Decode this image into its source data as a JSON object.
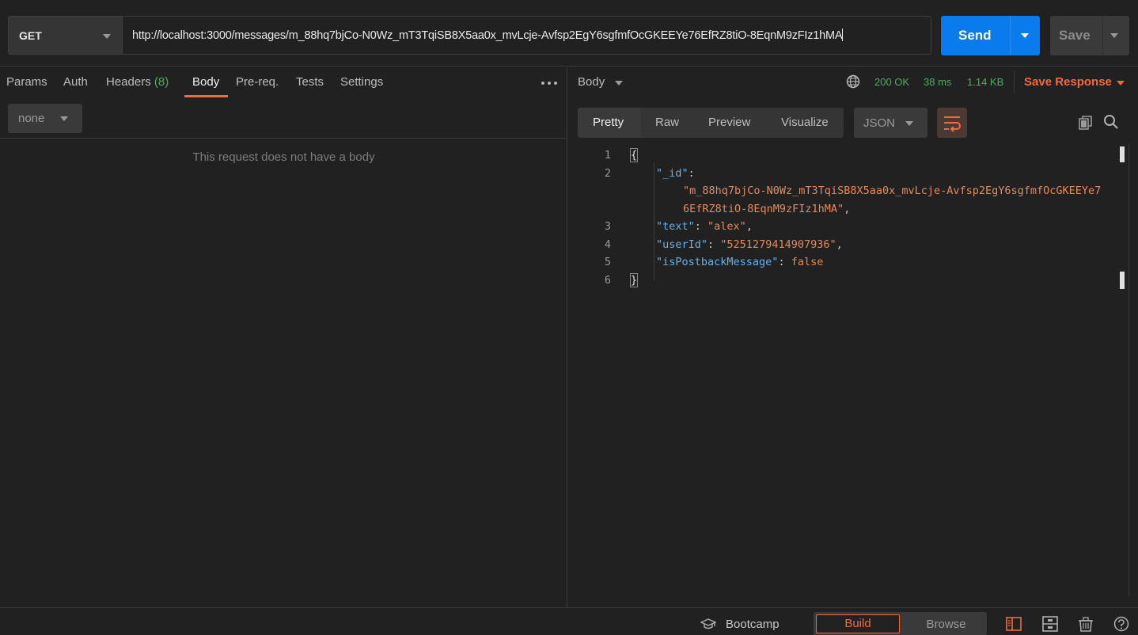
{
  "request": {
    "method": "GET",
    "url": "http://localhost:3000/messages/m_88hq7bjCo-N0Wz_mT3TqiSB8X5aa0x_mvLcje-Avfsp2EgY6sgfmfOcGKEEYe76EfRZ8tiO-8EqnM9zFIz1hMA",
    "send_label": "Send",
    "save_label": "Save"
  },
  "request_tabs": {
    "params": "Params",
    "auth": "Auth",
    "headers": "Headers",
    "headers_count": "(8)",
    "body": "Body",
    "prereq": "Pre-req.",
    "tests": "Tests",
    "settings": "Settings",
    "active": "Body"
  },
  "request_body": {
    "type": "none",
    "empty_message": "This request does not have a body"
  },
  "response": {
    "title": "Body",
    "status": "200 OK",
    "time": "38 ms",
    "size": "1.14 KB",
    "save_label": "Save Response",
    "view_tabs": [
      "Pretty",
      "Raw",
      "Preview",
      "Visualize"
    ],
    "active_view": "Pretty",
    "format": "JSON",
    "lines": [
      {
        "n": "1",
        "text": "{"
      },
      {
        "n": "2",
        "key": "\"_id\"",
        "colon": ":"
      },
      {
        "value_1": "\"m_88hq7bjCo-N0Wz_mT3TqiSB8X5aa0x_mvLcje-Avfsp2EgY6sgfmfOcGKEEYe7",
        "value_2": "6EfRZ8tiO-8EqnM9zFIz1hMA\"",
        "comma": ","
      },
      {
        "n": "3",
        "key": "\"text\"",
        "value": "\"alex\""
      },
      {
        "n": "4",
        "key": "\"userId\"",
        "value": "\"5251279414907936\""
      },
      {
        "n": "5",
        "key": "\"isPostbackMessage\"",
        "value": "false"
      },
      {
        "n": "6",
        "text": "}"
      }
    ]
  },
  "footer": {
    "bootcamp": "Bootcamp",
    "build": "Build",
    "browse": "Browse"
  },
  "colors": {
    "accent": "#f26b3a",
    "send": "#097bed",
    "success": "#4dae5e",
    "json_key": "#6bb0e6",
    "json_string": "#e38b5c"
  }
}
